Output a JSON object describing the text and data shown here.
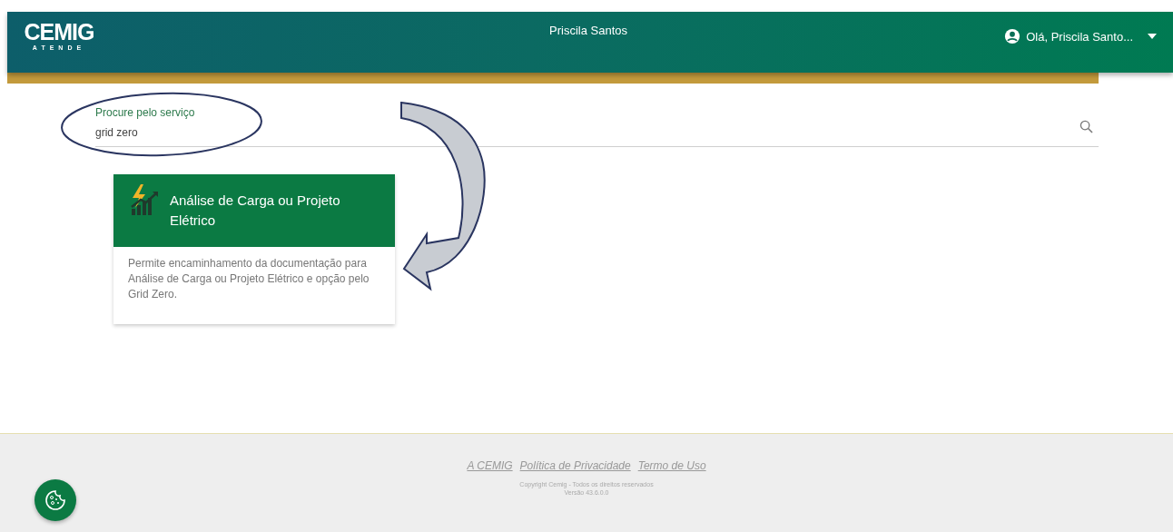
{
  "header": {
    "logo": {
      "brand": "CEMIG",
      "tagline": "ATENDE"
    },
    "center_name": "Priscila Santos",
    "user_menu": {
      "label": "Olá, Priscila Santo..."
    }
  },
  "search": {
    "label": "Procure pelo serviço",
    "value": "grid zero"
  },
  "services": [
    {
      "title": "Análise de Carga ou Projeto Elétrico",
      "description": "Permite encaminhamento da documentação para Análise de Carga ou Projeto Elétrico e opção pelo Grid Zero."
    }
  ],
  "footer": {
    "links": [
      "A CEMIG",
      "Política de Privacidade",
      "Termo de Uso"
    ],
    "copyright": "Copyright Cemig - Todos os direitos reservados",
    "version": "Versão 43.6.0.0"
  }
}
